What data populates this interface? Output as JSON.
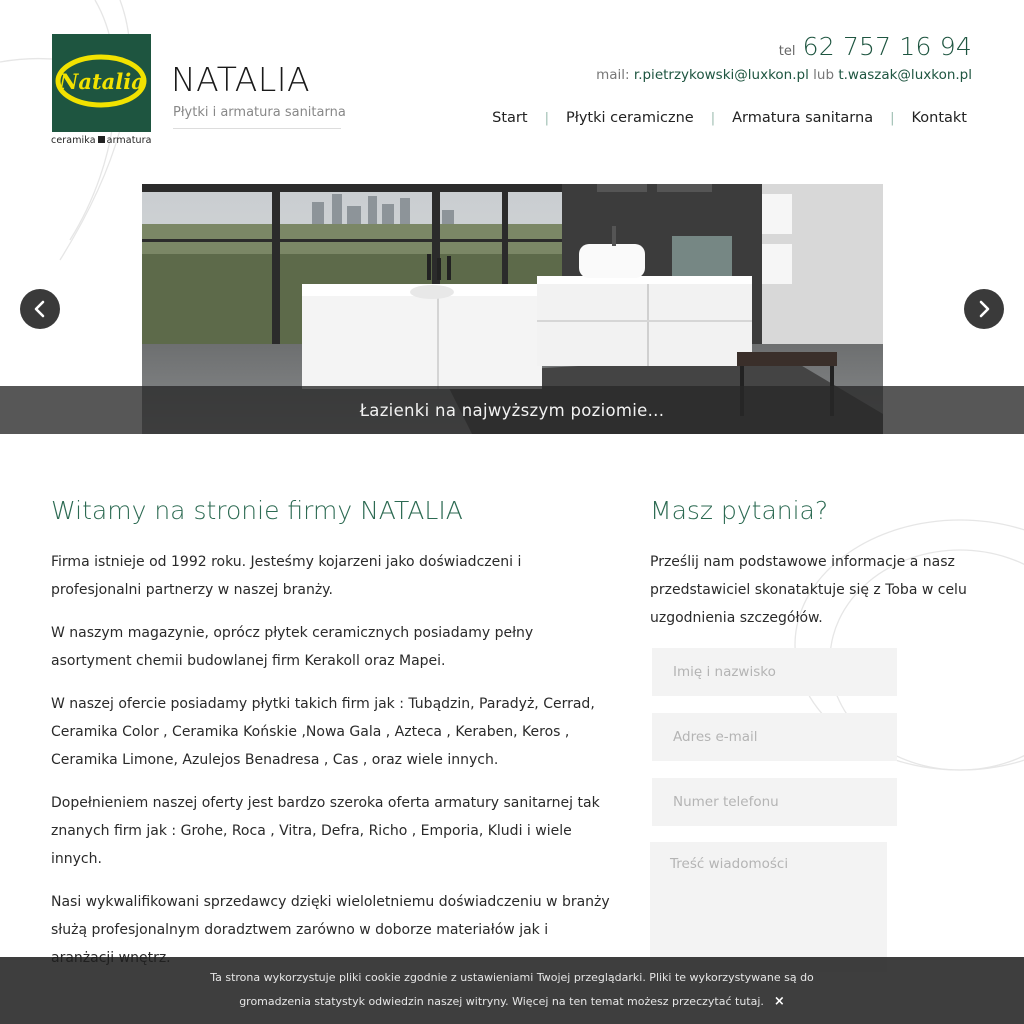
{
  "header": {
    "logo_text": "Natalia",
    "logo_tagline_left": "ceramika",
    "logo_tagline_right": "armatura",
    "brand_name": "NATALIA",
    "brand_subtitle": "Płytki i armatura sanitarna",
    "tel_prefix": "tel",
    "tel_number": "62 757 16 94",
    "mail_prefix": "mail:",
    "mail_1": "r.pietrzykowski@luxkon.pl",
    "mail_or": "lub",
    "mail_2": "t.waszak@luxkon.pl"
  },
  "nav": [
    {
      "label": "Start"
    },
    {
      "label": "Płytki ceramiczne"
    },
    {
      "label": "Armatura sanitarna"
    },
    {
      "label": "Kontakt"
    }
  ],
  "slider": {
    "caption": "Łazienki na najwyższym poziomie..."
  },
  "main": {
    "title": "Witamy na stronie firmy NATALIA",
    "paragraphs": [
      "Firma istnieje od 1992 roku. Jesteśmy kojarzeni jako doświadczeni i profesjonalni partnerzy  w naszej branży.",
      "W naszym magazynie, oprócz płytek ceramicznych posiadamy pełny asortyment chemii budowlanej firm Kerakoll oraz Mapei.",
      "W naszej ofercie posiadamy płytki takich firm jak : Tubądzin, Paradyż, Cerrad, Ceramika Color , Ceramika Końskie ,Nowa Gala , Azteca , Keraben, Keros , Ceramika Limone, Azulejos Benadresa , Cas , oraz wiele innych.",
      "Dopełnieniem naszej oferty jest bardzo szeroka oferta armatury sanitarnej tak znanych firm jak : Grohe, Roca , Vitra, Defra, Richo , Emporia, Kludi i wiele innych.",
      "Nasi wykwalifikowani sprzedawcy dzięki wieloletniemu doświadczeniu w branży służą profesjonalnym doradztwem zarówno w doborze materiałów jak i aranżacji wnętrz."
    ]
  },
  "sidebar": {
    "title": "Masz pytania?",
    "text": "Prześlij nam podstawowe informacje a nasz przedstawiciel skonataktuje się z Toba w celu uzgodnienia szczegółów.",
    "name_placeholder": "Imię i nazwisko",
    "email_placeholder": "Adres e-mail",
    "phone_placeholder": "Numer telefonu",
    "message_placeholder": "Treść wiadomości"
  },
  "cookie": {
    "line1": "Ta strona wykorzystuje pliki cookie zgodnie z ustawieniami Twojej przeglądarki. Pliki te wykorzystywane są do",
    "line2": "gromadzenia statystyk odwiedzin naszej witryny. Więcej na ten temat możesz przeczytać tutaj.",
    "close": "×"
  },
  "colors": {
    "brand_green": "#1e5540",
    "accent_green": "#2c6a52",
    "logo_yellow": "#f2e200"
  },
  "icons": {
    "prev": "chevron-left-icon",
    "next": "chevron-right-icon",
    "close": "close-icon"
  }
}
